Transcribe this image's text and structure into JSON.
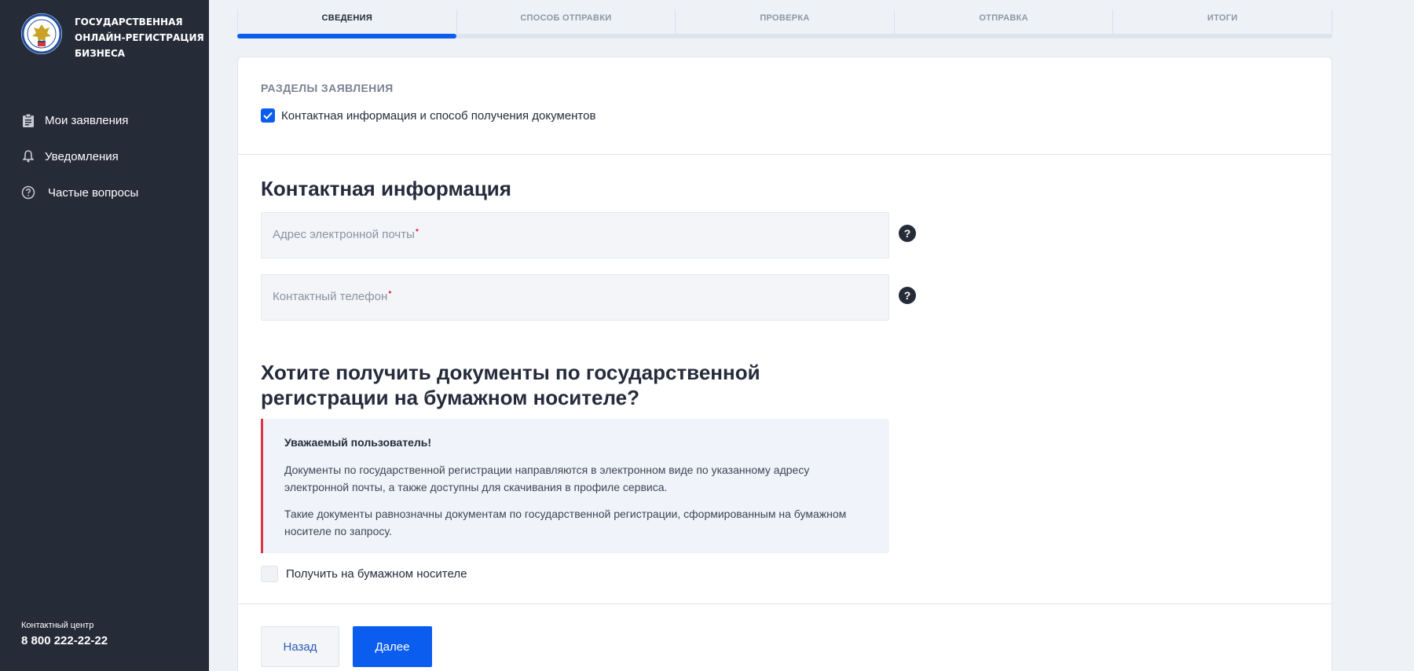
{
  "sidebar": {
    "brand_lines": [
      "Государственная",
      "онлайн-регистрация",
      "бизнеса"
    ],
    "nav": [
      {
        "label": "Мои заявления",
        "icon": "clipboard-icon"
      },
      {
        "label": "Уведомления",
        "icon": "bell-icon"
      },
      {
        "label": "Частые вопросы",
        "icon": "question-circle-icon"
      }
    ],
    "contact_label": "Контактный центр",
    "contact_phone": "8 800 222-22-22"
  },
  "stepper": {
    "steps": [
      "СВЕДЕНИЯ",
      "СПОСОБ ОТПРАВКИ",
      "ПРОВЕРКА",
      "ОТПРАВКА",
      "ИТОГИ"
    ],
    "active_index": 0,
    "progress_fraction": 0.2
  },
  "sections": {
    "title": "РАЗДЕЛЫ ЗАЯВЛЕНИЯ",
    "item_label": "Контактная информация и способ получения документов",
    "item_checked": true
  },
  "contact_info": {
    "heading": "Контактная информация",
    "email_placeholder": "Адрес электронной почты",
    "phone_placeholder": "Контактный телефон",
    "required_mark": "•",
    "help_glyph": "?"
  },
  "paper": {
    "heading": "Хотите получить документы по государственной регистрации на бумажном носителе?",
    "notice_title": "Уважаемый пользователь!",
    "notice_p1": "Документы по государственной регистрации направляются в электронном виде по указанному адресу электронной почты, а также доступны для скачивания в профиле сервиса.",
    "notice_p2": "Такие документы равнозначны документам по государственной регистрации, сформированным на бумажном носителе по запросу.",
    "checkbox_label": "Получить на бумажном носителе",
    "checkbox_checked": false
  },
  "buttons": {
    "back": "Назад",
    "next": "Далее"
  },
  "colors": {
    "sidebar_bg": "#262b38",
    "accent": "#0b5df0",
    "required": "#e0334a"
  }
}
